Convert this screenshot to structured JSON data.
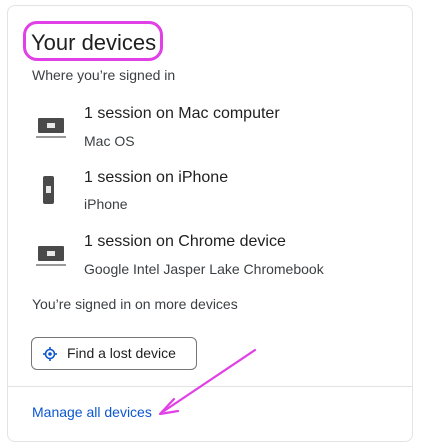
{
  "section": {
    "title": "Your devices",
    "subtitle": "Where you’re signed in"
  },
  "devices": [
    {
      "name": "1 session on Mac computer",
      "os": "Mac OS",
      "icon": "laptop-icon"
    },
    {
      "name": "1 session on iPhone",
      "os": "iPhone",
      "icon": "phone-icon"
    },
    {
      "name": "1 session on Chrome device",
      "os": "Google Intel Jasper Lake Chromebook",
      "icon": "laptop-icon"
    }
  ],
  "more_devices_text": "You’re signed in on more devices",
  "find_button": {
    "label": "Find a lost device",
    "icon": "locate-icon"
  },
  "manage_link": "Manage all devices",
  "colors": {
    "highlight": "#e040e6",
    "link": "#0b57d0",
    "icon": "#4a4a4a"
  }
}
